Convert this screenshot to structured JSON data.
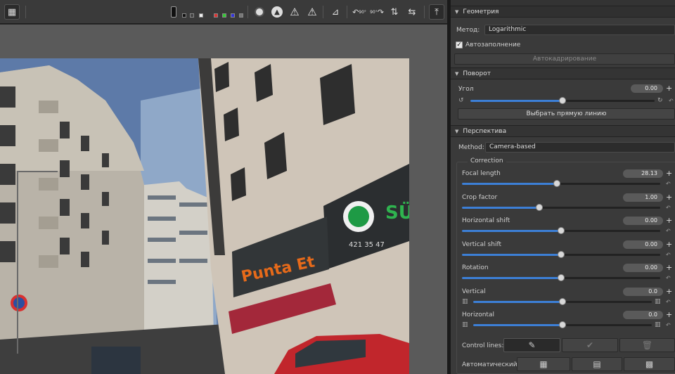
{
  "toolbar": {
    "icons": [
      "grid-view-icon",
      "swatch-black",
      "swatch-white",
      "swatch-red",
      "swatch-green",
      "swatch-blue",
      "swatch-gray",
      "clip-icon",
      "shadow-warning-icon",
      "highlight-warning-icon",
      "highlight-warning-filled-icon",
      "perspective-icon",
      "rotate-ccw-icon",
      "rotate-cw-icon",
      "flip-vertical-icon",
      "flip-horizontal-icon",
      "expand-up-icon"
    ],
    "rotate_ccw_label": "90°",
    "rotate_cw_label": "90°"
  },
  "photo": {
    "sign_text": "Punta Et",
    "sign_logo_text": "SÜ",
    "phone_text": "421 35 47"
  },
  "geometry": {
    "header": "Геометрия",
    "method_label": "Метод:",
    "method_value": "Logarithmic",
    "autofill_label": "Автозаполнение",
    "autofill_checked": true,
    "autocrop_button": "Автокадрирование"
  },
  "rotation": {
    "header": "Поворот",
    "angle_label": "Угол",
    "angle_value": "0.00",
    "angle_fraction": 0.5,
    "straighten_button": "Выбрать прямую линию"
  },
  "perspective": {
    "header": "Перспектива",
    "method_label": "Method:",
    "method_value": "Camera-based",
    "correction_label": "Correction",
    "sliders": [
      {
        "label": "Focal length",
        "value": "28.13",
        "fraction": 0.48
      },
      {
        "label": "Crop factor",
        "value": "1.00",
        "fraction": 0.39
      },
      {
        "label": "Horizontal shift",
        "value": "0.00",
        "fraction": 0.5
      },
      {
        "label": "Vertical shift",
        "value": "0.00",
        "fraction": 0.5
      },
      {
        "label": "Rotation",
        "value": "0.00",
        "fraction": 0.5
      },
      {
        "label": "Vertical",
        "value": "0.0",
        "fraction": 0.5
      },
      {
        "label": "Horizontal",
        "value": "0.0",
        "fraction": 0.5
      }
    ],
    "control_lines_label": "Control lines:",
    "auto_label": "Автоматический:"
  }
}
